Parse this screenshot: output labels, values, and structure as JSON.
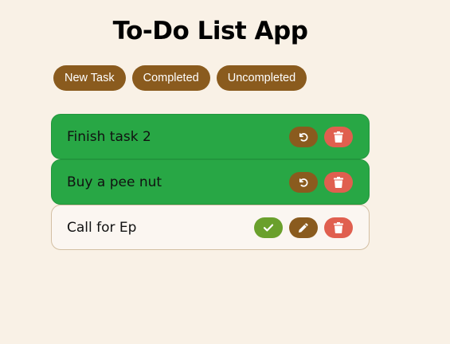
{
  "app": {
    "title": "To-Do List App"
  },
  "filters": {
    "new_task": "New Task",
    "completed": "Completed",
    "uncompleted": "Uncompleted"
  },
  "tasks": [
    {
      "text": "Finish task 2",
      "status": "completed"
    },
    {
      "text": "Buy a pee nut",
      "status": "completed"
    },
    {
      "text": "Call for Ep",
      "status": "uncompleted"
    }
  ],
  "icons": {
    "undo": "undo-icon",
    "check": "check-icon",
    "edit": "pencil-icon",
    "delete": "trash-icon"
  },
  "colors": {
    "background": "#f9f1e6",
    "accent_brown": "#8a5b1e",
    "completed_green": "#28a745",
    "check_green": "#6aa02c",
    "delete_red": "#e05f4f"
  }
}
